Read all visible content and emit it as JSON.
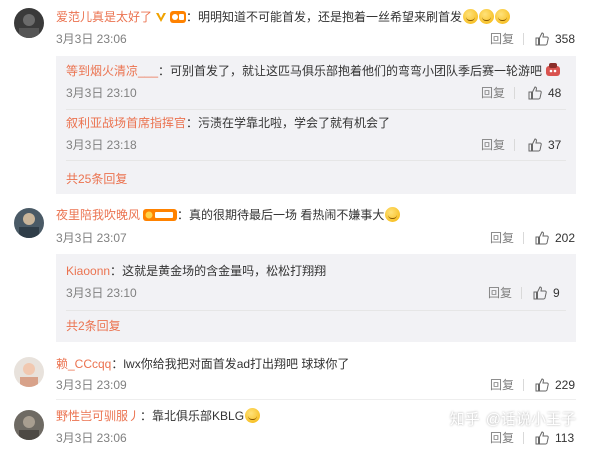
{
  "reply_label": "回复",
  "comments": [
    {
      "username": "爱范儿真是太好了",
      "separator": "：",
      "text": "明明知道不可能首发，还是抱着一丝希望来刷首发",
      "date": "3月3日 23:06",
      "likes": "358",
      "replies": [
        {
          "username": "等到烟火清凉___",
          "separator": "：",
          "text": "可别首发了，就让这匹马俱乐部抱着他们的弯弯小团队季后赛一轮游吧",
          "date": "3月3日 23:10",
          "likes": "48"
        },
        {
          "username": "叙利亚战场首席指挥官",
          "separator": "：",
          "text": "污渍在学靠北啦，学会了就有机会了",
          "date": "3月3日 23:18",
          "likes": "37"
        }
      ],
      "more_replies": "共25条回复"
    },
    {
      "username": "夜里陪我吹晚风",
      "separator": "：",
      "text": "真的很期待最后一场 看热闹不嫌事大",
      "date": "3月3日 23:07",
      "likes": "202",
      "replies": [
        {
          "username": "Kiaoonn",
          "separator": "：",
          "text": "这就是黄金场的含金量吗，松松打翔翔",
          "date": "3月3日 23:10",
          "likes": "9"
        }
      ],
      "more_replies": "共2条回复"
    },
    {
      "username": "赖_CCcqq",
      "separator": "：",
      "text": "lwx你给我把对面首发ad打出翔吧 球球你了",
      "date": "3月3日 23:09",
      "likes": "229"
    },
    {
      "username": "野性岂可驯服丿",
      "separator": "：",
      "text": "靠北俱乐部KBLG",
      "date": "3月3日 23:06",
      "likes": "113"
    }
  ],
  "watermark": {
    "site": "知乎",
    "author": "@话说小王子"
  },
  "colors": {
    "username": "#eb7350",
    "meta": "#808080",
    "sub_bg": "#f2f2f5",
    "badge": "#ff8200"
  }
}
